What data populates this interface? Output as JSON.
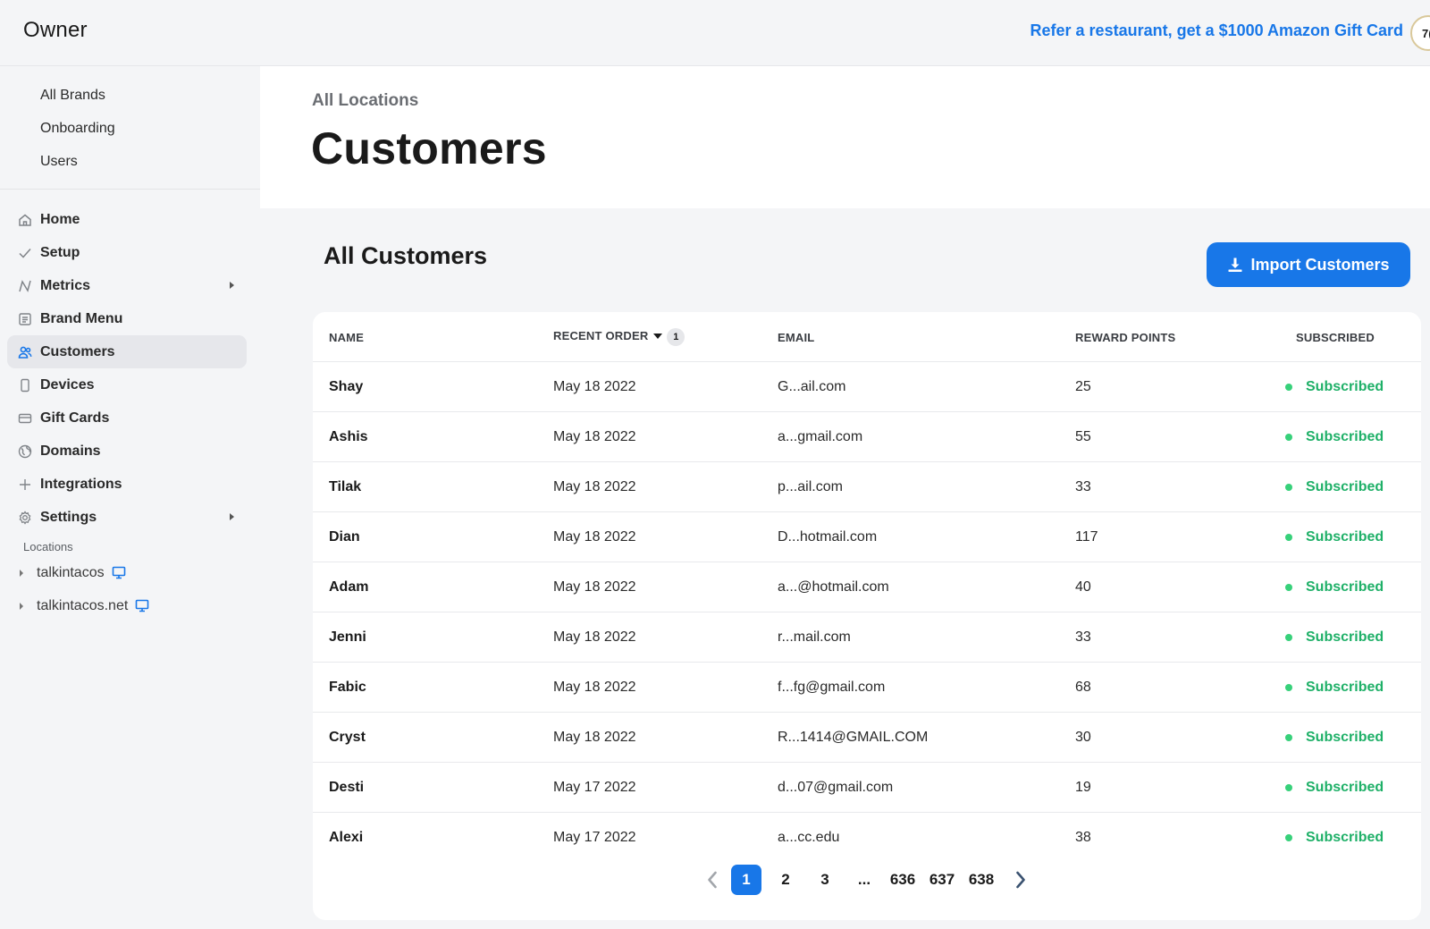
{
  "header": {
    "logo": "Owner",
    "refer_link": "Refer a restaurant, get a $1000 Amazon Gift Card",
    "avatar_text": "7("
  },
  "sidebar": {
    "brand_links": [
      "All Brands",
      "Onboarding",
      "Users"
    ],
    "nav": [
      {
        "label": "Home",
        "icon": "home-icon"
      },
      {
        "label": "Setup",
        "icon": "check-icon"
      },
      {
        "label": "Metrics",
        "icon": "metrics-icon",
        "expandable": true
      },
      {
        "label": "Brand Menu",
        "icon": "menu-icon"
      },
      {
        "label": "Customers",
        "icon": "users-icon",
        "active": true
      },
      {
        "label": "Devices",
        "icon": "device-icon"
      },
      {
        "label": "Gift Cards",
        "icon": "card-icon"
      },
      {
        "label": "Domains",
        "icon": "globe-icon"
      },
      {
        "label": "Integrations",
        "icon": "plus-icon"
      },
      {
        "label": "Settings",
        "icon": "gear-icon",
        "expandable": true
      }
    ],
    "locations_label": "Locations",
    "locations": [
      "talkintacos",
      "talkintacos.net"
    ]
  },
  "page": {
    "breadcrumb": "All Locations",
    "title": "Customers",
    "section_title": "All Customers",
    "import_button": "Import Customers"
  },
  "table": {
    "headers": {
      "name": "NAME",
      "recent_order": "RECENT ORDER",
      "sort_badge": "1",
      "email": "EMAIL",
      "reward_points": "REWARD POINTS",
      "subscribed": "SUBSCRIBED"
    },
    "rows": [
      {
        "name": "Shay",
        "date": "May 18 2022",
        "email": "G...ail.com",
        "points": "25",
        "status": "Subscribed"
      },
      {
        "name": "Ashis",
        "date": "May 18 2022",
        "email": "a...gmail.com",
        "points": "55",
        "status": "Subscribed"
      },
      {
        "name": "Tilak",
        "date": "May 18 2022",
        "email": "p...ail.com",
        "points": "33",
        "status": "Subscribed"
      },
      {
        "name": "Dian",
        "date": "May 18 2022",
        "email": "D...hotmail.com",
        "points": "117",
        "status": "Subscribed"
      },
      {
        "name": "Adam",
        "date": "May 18 2022",
        "email": "a...@hotmail.com",
        "points": "40",
        "status": "Subscribed"
      },
      {
        "name": "Jenni",
        "date": "May 18 2022",
        "email": "r...mail.com",
        "points": "33",
        "status": "Subscribed"
      },
      {
        "name": "Fabic",
        "date": "May 18 2022",
        "email": "f...fg@gmail.com",
        "points": "68",
        "status": "Subscribed"
      },
      {
        "name": "Cryst",
        "date": "May 18 2022",
        "email": "R...1414@GMAIL.COM",
        "points": "30",
        "status": "Subscribed"
      },
      {
        "name": "Desti",
        "date": "May 17 2022",
        "email": "d...07@gmail.com",
        "points": "19",
        "status": "Subscribed"
      },
      {
        "name": "Alexi",
        "date": "May 17 2022",
        "email": "a...cc.edu",
        "points": "38",
        "status": "Subscribed"
      }
    ]
  },
  "pagination": {
    "pages": [
      "1",
      "2",
      "3",
      "...",
      "636",
      "637",
      "638"
    ],
    "current": "1"
  },
  "colors": {
    "accent": "#1877e8",
    "subscribed": "#1fb068",
    "sidebar_bg": "#f4f5f7"
  }
}
